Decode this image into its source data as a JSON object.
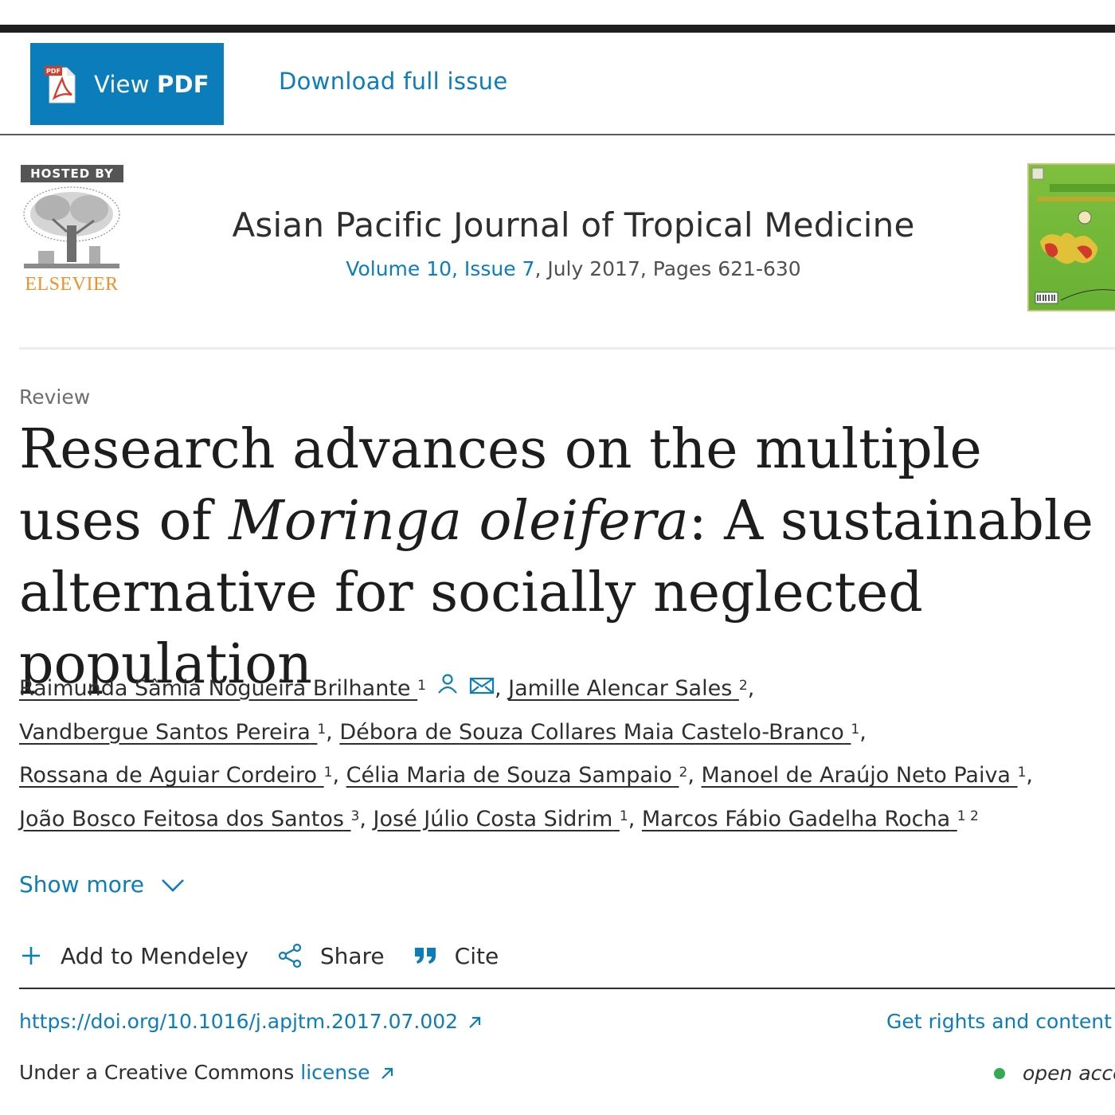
{
  "toolbar": {
    "view_pdf_prefix": "View ",
    "view_pdf_bold": "PDF",
    "download_label": "Download full issue"
  },
  "header": {
    "hosted_by": "HOSTED BY",
    "publisher": "ELSEVIER",
    "journal_title": "Asian Pacific Journal of Tropical Medicine",
    "volume_link": "Volume 10, Issue 7",
    "meta_rest": ", July 2017, Pages 621-630"
  },
  "article": {
    "type": "Review",
    "title_part1": "Research advances on the multiple uses of ",
    "title_italic": "Moringa oleifera",
    "title_part2": ": A sustainable alternative for socially neglected population"
  },
  "authors": [
    {
      "name": "Raimunda Sâmia Nogueira Brilhante",
      "sup": "1"
    },
    {
      "name": "Jamille Alencar Sales",
      "sup": "2"
    },
    {
      "name": "Vandbergue Santos Pereira",
      "sup": "1"
    },
    {
      "name": "Débora de Souza Collares Maia Castelo-Branco",
      "sup": "1"
    },
    {
      "name": "Rossana de Aguiar Cordeiro",
      "sup": "1"
    },
    {
      "name": "Célia Maria de Souza Sampaio",
      "sup": "2"
    },
    {
      "name": "Manoel de Araújo Neto Paiva",
      "sup": "1"
    },
    {
      "name": "João Bosco Feitosa dos Santos",
      "sup": "3"
    },
    {
      "name": "José Júlio Costa Sidrim",
      "sup": "1"
    },
    {
      "name": "Marcos Fábio Gadelha Rocha",
      "sup": "1 2"
    }
  ],
  "show_more": "Show more",
  "actions": {
    "mendeley": "Add to Mendeley",
    "share": "Share",
    "cite": "Cite"
  },
  "doi": "https://doi.org/10.1016/j.apjtm.2017.07.002",
  "rights": "Get rights and content",
  "license_prefix": "Under a Creative Commons",
  "license_link": "license",
  "open_access": "open access",
  "colors": {
    "accent": "#0c7dbb",
    "pdf_button": "#0c7dbb",
    "elsevier_orange": "#f28f2a",
    "oa_green": "#34a853"
  },
  "icons": [
    "pdf-icon",
    "person-icon",
    "envelope-icon",
    "chevron-down-icon",
    "plus-icon",
    "share-icon",
    "quote-icon",
    "external-link-icon"
  ]
}
